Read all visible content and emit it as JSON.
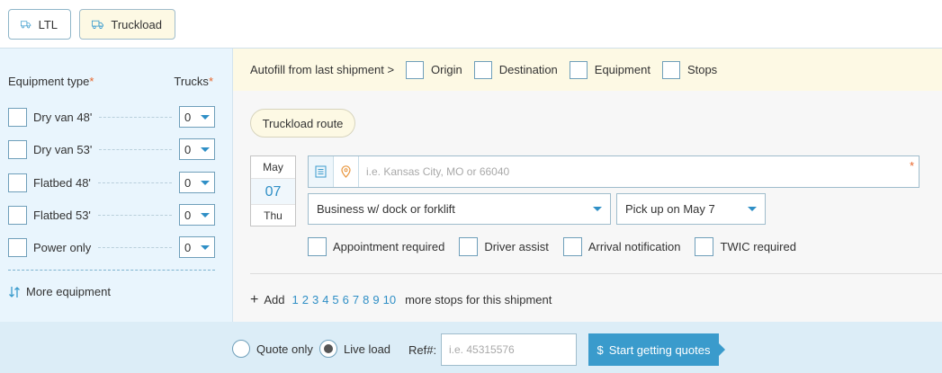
{
  "modes": {
    "ltl_label": "LTL",
    "truckload_label": "Truckload",
    "selected": "Truckload"
  },
  "equipment": {
    "type_header": "Equipment type",
    "trucks_header": "Trucks",
    "required_mark": "*",
    "items": [
      {
        "label": "Dry van 48'",
        "qty": "0"
      },
      {
        "label": "Dry van 53'",
        "qty": "0"
      },
      {
        "label": "Flatbed 48'",
        "qty": "0"
      },
      {
        "label": "Flatbed 53'",
        "qty": "0"
      },
      {
        "label": "Power only",
        "qty": "0"
      }
    ],
    "more_label": "More equipment"
  },
  "autofill": {
    "label": "Autofill from last shipment >",
    "options": [
      "Origin",
      "Destination",
      "Equipment",
      "Stops"
    ]
  },
  "route": {
    "pill_label": "Truckload route",
    "date": {
      "month": "May",
      "day": "07",
      "weekday": "Thu"
    },
    "address_placeholder": "i.e. Kansas City, MO or 66040",
    "required_mark": "*",
    "location_type": "Business w/ dock or forklift",
    "pickup": "Pick up on May 7",
    "accessorials": [
      "Appointment required",
      "Driver assist",
      "Arrival notification",
      "TWIC required"
    ]
  },
  "stops": {
    "add_label": "Add",
    "numbers": [
      "1",
      "2",
      "3",
      "4",
      "5",
      "6",
      "7",
      "8",
      "9",
      "10"
    ],
    "suffix": "more stops for this shipment"
  },
  "footer": {
    "quote_only_label": "Quote only",
    "live_load_label": "Live load",
    "selected_radio": "Live load",
    "ref_label": "Ref#:",
    "ref_placeholder": "i.e. 45315576",
    "start_label": "Start getting quotes",
    "start_icon": "$"
  },
  "colors": {
    "accent": "#2f8fc6",
    "required": "#e8652a",
    "sidebar_bg": "#e9f5fd",
    "highlight_bg": "#fdf9e4",
    "cta": "#3a9bcc"
  }
}
